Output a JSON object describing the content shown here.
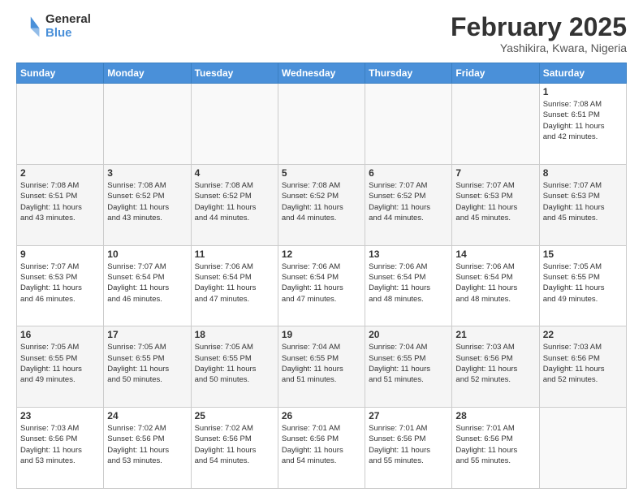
{
  "logo": {
    "general": "General",
    "blue": "Blue"
  },
  "title": "February 2025",
  "subtitle": "Yashikira, Kwara, Nigeria",
  "days_of_week": [
    "Sunday",
    "Monday",
    "Tuesday",
    "Wednesday",
    "Thursday",
    "Friday",
    "Saturday"
  ],
  "weeks": [
    {
      "days": [
        {
          "num": "",
          "info": ""
        },
        {
          "num": "",
          "info": ""
        },
        {
          "num": "",
          "info": ""
        },
        {
          "num": "",
          "info": ""
        },
        {
          "num": "",
          "info": ""
        },
        {
          "num": "",
          "info": ""
        },
        {
          "num": "1",
          "info": "Sunrise: 7:08 AM\nSunset: 6:51 PM\nDaylight: 11 hours\nand 42 minutes."
        }
      ]
    },
    {
      "days": [
        {
          "num": "2",
          "info": "Sunrise: 7:08 AM\nSunset: 6:51 PM\nDaylight: 11 hours\nand 43 minutes."
        },
        {
          "num": "3",
          "info": "Sunrise: 7:08 AM\nSunset: 6:52 PM\nDaylight: 11 hours\nand 43 minutes."
        },
        {
          "num": "4",
          "info": "Sunrise: 7:08 AM\nSunset: 6:52 PM\nDaylight: 11 hours\nand 44 minutes."
        },
        {
          "num": "5",
          "info": "Sunrise: 7:08 AM\nSunset: 6:52 PM\nDaylight: 11 hours\nand 44 minutes."
        },
        {
          "num": "6",
          "info": "Sunrise: 7:07 AM\nSunset: 6:52 PM\nDaylight: 11 hours\nand 44 minutes."
        },
        {
          "num": "7",
          "info": "Sunrise: 7:07 AM\nSunset: 6:53 PM\nDaylight: 11 hours\nand 45 minutes."
        },
        {
          "num": "8",
          "info": "Sunrise: 7:07 AM\nSunset: 6:53 PM\nDaylight: 11 hours\nand 45 minutes."
        }
      ]
    },
    {
      "days": [
        {
          "num": "9",
          "info": "Sunrise: 7:07 AM\nSunset: 6:53 PM\nDaylight: 11 hours\nand 46 minutes."
        },
        {
          "num": "10",
          "info": "Sunrise: 7:07 AM\nSunset: 6:54 PM\nDaylight: 11 hours\nand 46 minutes."
        },
        {
          "num": "11",
          "info": "Sunrise: 7:06 AM\nSunset: 6:54 PM\nDaylight: 11 hours\nand 47 minutes."
        },
        {
          "num": "12",
          "info": "Sunrise: 7:06 AM\nSunset: 6:54 PM\nDaylight: 11 hours\nand 47 minutes."
        },
        {
          "num": "13",
          "info": "Sunrise: 7:06 AM\nSunset: 6:54 PM\nDaylight: 11 hours\nand 48 minutes."
        },
        {
          "num": "14",
          "info": "Sunrise: 7:06 AM\nSunset: 6:54 PM\nDaylight: 11 hours\nand 48 minutes."
        },
        {
          "num": "15",
          "info": "Sunrise: 7:05 AM\nSunset: 6:55 PM\nDaylight: 11 hours\nand 49 minutes."
        }
      ]
    },
    {
      "days": [
        {
          "num": "16",
          "info": "Sunrise: 7:05 AM\nSunset: 6:55 PM\nDaylight: 11 hours\nand 49 minutes."
        },
        {
          "num": "17",
          "info": "Sunrise: 7:05 AM\nSunset: 6:55 PM\nDaylight: 11 hours\nand 50 minutes."
        },
        {
          "num": "18",
          "info": "Sunrise: 7:05 AM\nSunset: 6:55 PM\nDaylight: 11 hours\nand 50 minutes."
        },
        {
          "num": "19",
          "info": "Sunrise: 7:04 AM\nSunset: 6:55 PM\nDaylight: 11 hours\nand 51 minutes."
        },
        {
          "num": "20",
          "info": "Sunrise: 7:04 AM\nSunset: 6:55 PM\nDaylight: 11 hours\nand 51 minutes."
        },
        {
          "num": "21",
          "info": "Sunrise: 7:03 AM\nSunset: 6:56 PM\nDaylight: 11 hours\nand 52 minutes."
        },
        {
          "num": "22",
          "info": "Sunrise: 7:03 AM\nSunset: 6:56 PM\nDaylight: 11 hours\nand 52 minutes."
        }
      ]
    },
    {
      "days": [
        {
          "num": "23",
          "info": "Sunrise: 7:03 AM\nSunset: 6:56 PM\nDaylight: 11 hours\nand 53 minutes."
        },
        {
          "num": "24",
          "info": "Sunrise: 7:02 AM\nSunset: 6:56 PM\nDaylight: 11 hours\nand 53 minutes."
        },
        {
          "num": "25",
          "info": "Sunrise: 7:02 AM\nSunset: 6:56 PM\nDaylight: 11 hours\nand 54 minutes."
        },
        {
          "num": "26",
          "info": "Sunrise: 7:01 AM\nSunset: 6:56 PM\nDaylight: 11 hours\nand 54 minutes."
        },
        {
          "num": "27",
          "info": "Sunrise: 7:01 AM\nSunset: 6:56 PM\nDaylight: 11 hours\nand 55 minutes."
        },
        {
          "num": "28",
          "info": "Sunrise: 7:01 AM\nSunset: 6:56 PM\nDaylight: 11 hours\nand 55 minutes."
        },
        {
          "num": "",
          "info": ""
        }
      ]
    }
  ]
}
